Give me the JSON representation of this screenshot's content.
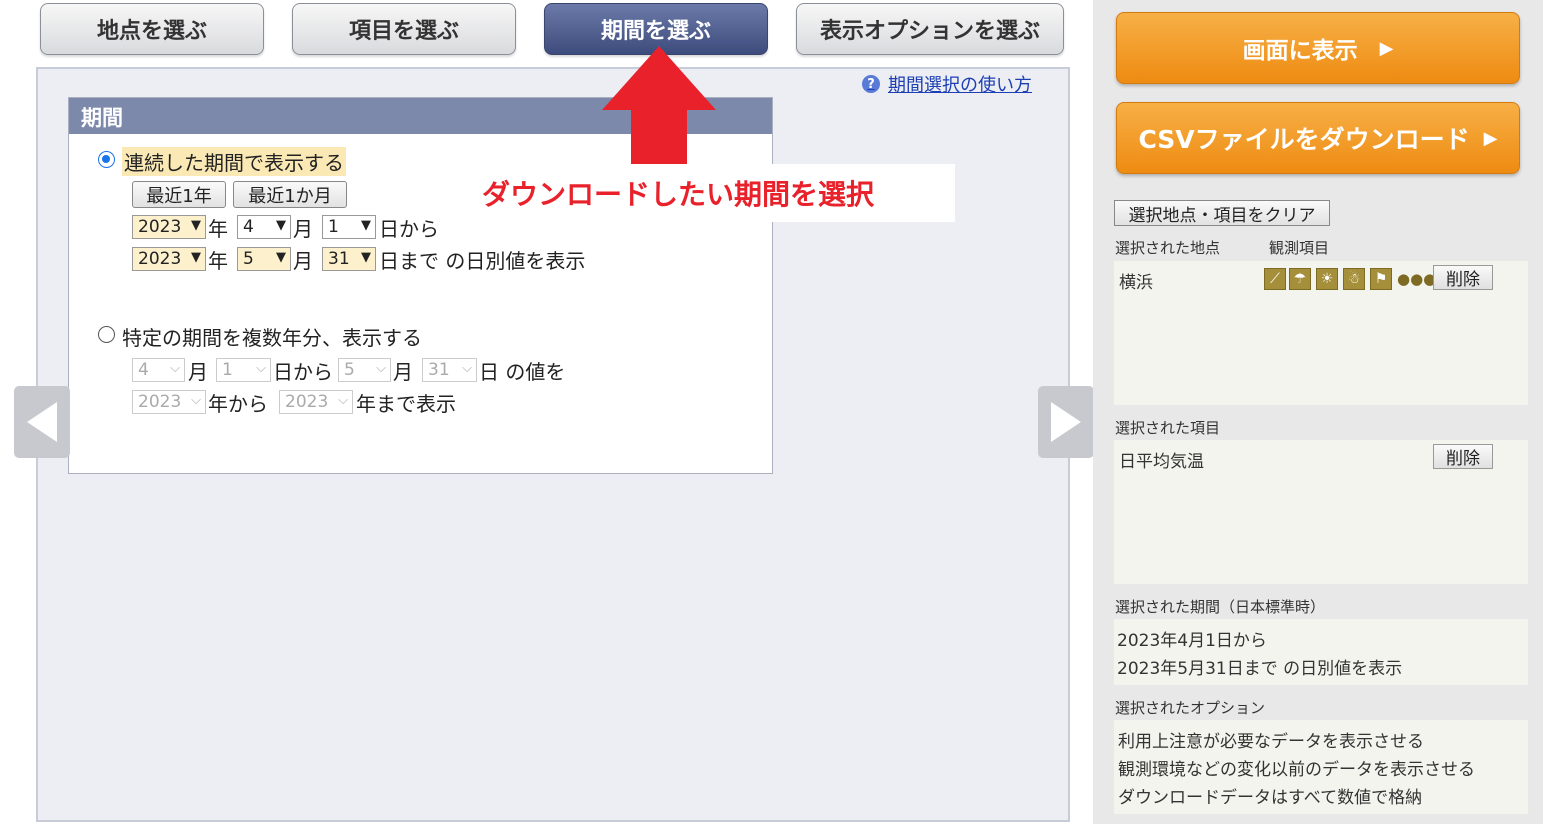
{
  "tabs": [
    {
      "label": "地点を選ぶ"
    },
    {
      "label": "項目を選ぶ"
    },
    {
      "label": "期間を選ぶ"
    },
    {
      "label": "表示オプションを選ぶ"
    }
  ],
  "help_link": "期間選択の使い方",
  "period": {
    "heading": "期間",
    "continuous_label": "連続した期間で表示する",
    "recent_year": "最近1年",
    "recent_month": "最近1か月",
    "from_year": "2023",
    "from_month": "4",
    "from_day": "1",
    "to_year": "2023",
    "to_month": "5",
    "to_day": "31",
    "unit_year": "年",
    "unit_month": "月",
    "from_suffix": "日から",
    "to_suffix": "日まで の日別値を表示",
    "multi_label": "特定の期間を複数年分、表示する",
    "multi_from_month": "4",
    "multi_from_day": "1",
    "multi_to_month": "5",
    "multi_to_day": "31",
    "multi_from_year": "2023",
    "multi_to_year": "2023",
    "multi_day_from": "日から",
    "multi_day_value": "日 の値を",
    "multi_year_from": "年から",
    "multi_year_to": "年まで表示"
  },
  "annotation": "ダウンロードしたい期間を選択",
  "sidebar": {
    "show_button": "画面に表示",
    "csv_button": "CSVファイルをダウンロード",
    "clear_button": "選択地点・項目をクリア",
    "selected_station_caption": "選択された地点",
    "observed_items_caption": "観測項目",
    "station": "横浜",
    "delete": "削除",
    "selected_items_caption": "選択された項目",
    "item": "日平均気温",
    "selected_period_caption": "選択された期間（日本標準時）",
    "period_line1": "2023年4月1日から",
    "period_line2": "2023年5月31日まで の日別値を表示",
    "selected_options_caption": "選択されたオプション",
    "options": [
      "利用上注意が必要なデータを表示させる",
      "観測環境などの変化以前のデータを表示させる",
      "ダウンロードデータはすべて数値で格納"
    ]
  },
  "colors": {
    "active_tab": "#3e4c7d",
    "orange": "#ee8b12",
    "annotation_red": "#e8212b",
    "period_header": "#7c89ab"
  }
}
